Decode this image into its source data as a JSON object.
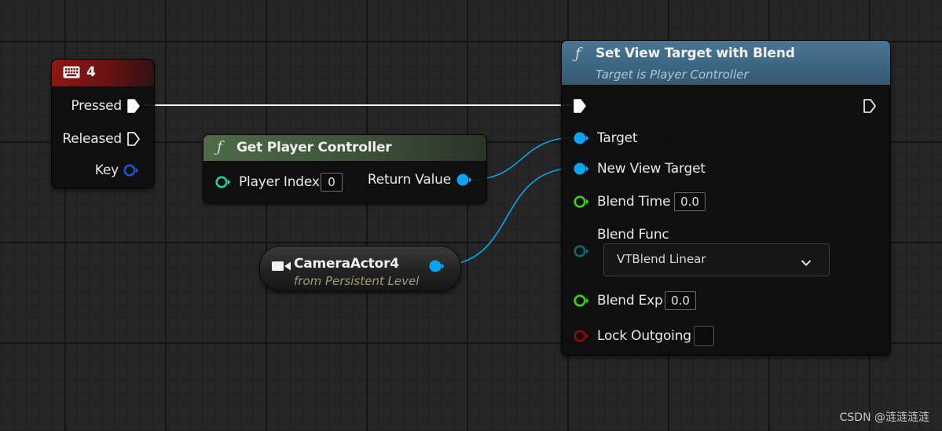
{
  "nodes": {
    "key_event": {
      "title": "4",
      "header_color": "#8e1717",
      "icon": "keyboard-icon",
      "pins": {
        "pressed": "Pressed",
        "released": "Released",
        "key": "Key"
      }
    },
    "get_player_controller": {
      "title": "Get Player Controller",
      "header_color": "#4e6a48",
      "icon": "function-icon",
      "icon_glyph": "ƒ",
      "pins": {
        "player_index": "Player Index",
        "player_index_value": "0",
        "return_value": "Return Value"
      }
    },
    "camera_actor": {
      "title": "CameraActor4",
      "subtitle": "from Persistent Level",
      "icon": "camera-icon"
    },
    "set_view_target": {
      "title": "Set View Target with Blend",
      "subtitle": "Target is Player Controller",
      "header_color": "#4a7592",
      "icon": "function-icon",
      "icon_glyph": "ƒ",
      "pins": {
        "target": "Target",
        "new_view_target": "New View Target",
        "blend_time": "Blend Time",
        "blend_time_value": "0.0",
        "blend_func": "Blend Func",
        "blend_func_selected": "VTBlend Linear",
        "blend_exp": "Blend Exp",
        "blend_exp_value": "0.0",
        "lock_outgoing": "Lock Outgoing",
        "lock_outgoing_checked": false
      }
    }
  },
  "colors": {
    "exec_pin": "#ffffff",
    "object_pin": "#0aa5f0",
    "struct_key_pin": "#1d55c8",
    "int_pin": "#1fcf9a",
    "float_pin": "#38d21c",
    "byte_pin": "#0b6c66",
    "bool_pin": "#8e0a0a",
    "wire_exec": "#ffffff",
    "wire_object": "#0aa5f0"
  },
  "watermark": "CSDN @涟涟涟涟"
}
